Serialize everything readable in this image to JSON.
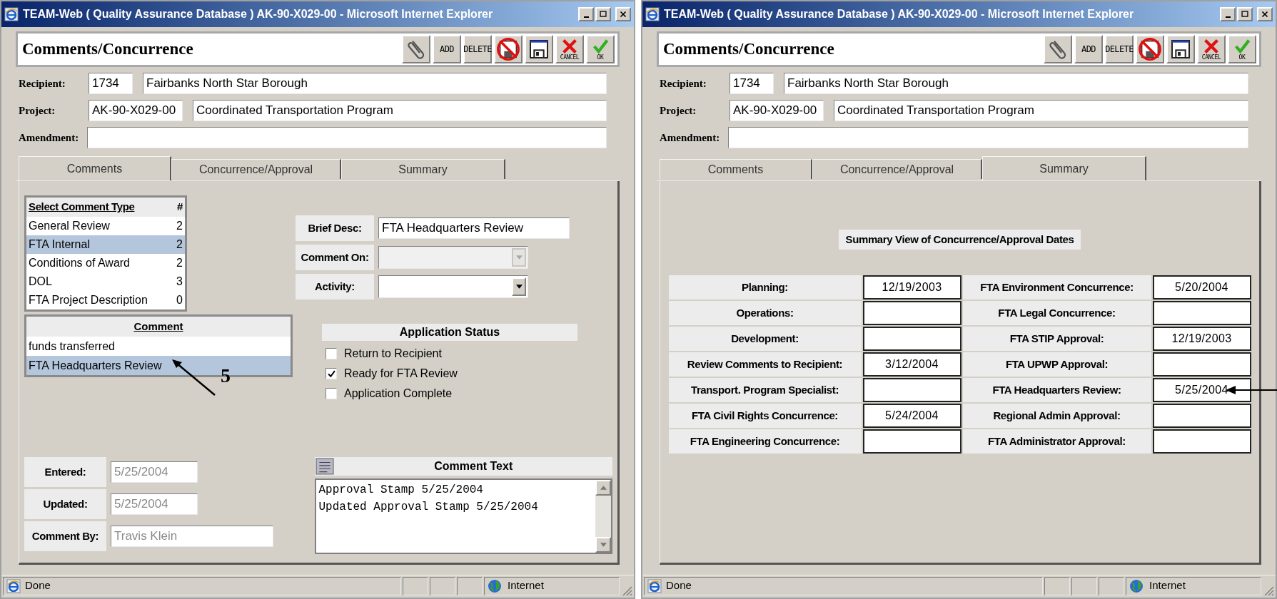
{
  "windows": [
    {
      "title": "TEAM-Web ( Quality Assurance Database ) AK-90-X029-00 - Microsoft Internet Explorer",
      "form_title": "Comments/Concurrence",
      "toolbar": [
        {
          "kind": "attach"
        },
        {
          "kind": "text",
          "label": "ADD"
        },
        {
          "kind": "text",
          "label": "DELETE"
        },
        {
          "kind": "nosave"
        },
        {
          "kind": "save"
        },
        {
          "kind": "cancel",
          "label": "CANCEL"
        },
        {
          "kind": "ok",
          "label": "OK"
        }
      ],
      "fields": [
        {
          "label": "Recipient:",
          "code": "1734",
          "name": "Fairbanks North Star Borough"
        },
        {
          "label": "Project:",
          "code": "AK-90-X029-00",
          "name": "Coordinated Transportation Program"
        },
        {
          "label": "Amendment:"
        }
      ],
      "tabs": [
        {
          "label": "Comments",
          "selected": true
        },
        {
          "label": "Concurrence/Approval",
          "selected": false
        },
        {
          "label": "Summary",
          "selected": false
        }
      ],
      "body": {
        "kind": "comments",
        "comment_types": {
          "columns": [
            "Select Comment Type",
            "#"
          ],
          "rows": [
            {
              "name": "General Review",
              "count": "2",
              "selected": false
            },
            {
              "name": "FTA Internal",
              "count": "2",
              "selected": true
            },
            {
              "name": "Conditions of Award",
              "count": "2",
              "selected": false
            },
            {
              "name": "DOL",
              "count": "3",
              "selected": false
            },
            {
              "name": "FTA Project Description",
              "count": "0",
              "selected": false
            }
          ]
        },
        "comments": {
          "heading": "Comment",
          "rows": [
            {
              "text": "funds transferred",
              "selected": false,
              "pointer": false
            },
            {
              "text": "FTA Headquarters Review",
              "selected": true,
              "pointer": true
            }
          ]
        },
        "annotation": "5",
        "selects": [
          {
            "label": "Brief Desc:",
            "kind": "text",
            "value": "FTA Headquarters Review"
          },
          {
            "label": "Comment On:",
            "kind": "dropdown",
            "disabled": true
          },
          {
            "label": "Activity:",
            "kind": "dropdown",
            "disabled": false
          }
        ],
        "application_status": {
          "title": "Application Status",
          "options": [
            {
              "label": "Return to Recipient",
              "checked": false
            },
            {
              "label": "Ready for FTA Review",
              "checked": true
            },
            {
              "label": "Application Complete",
              "checked": false
            }
          ]
        },
        "meta": [
          {
            "label": "Entered:",
            "value": "5/25/2004"
          },
          {
            "label": "Updated:",
            "value": "5/25/2004"
          },
          {
            "label": "Comment By:",
            "value": "Travis Klein"
          }
        ],
        "comment_text": {
          "title": "Comment Text",
          "lines": [
            "Approval Stamp 5/25/2004",
            "Updated Approval Stamp 5/25/2004"
          ]
        }
      },
      "status_bar": {
        "text": "Done",
        "zone": "Internet"
      }
    },
    {
      "title": "TEAM-Web ( Quality Assurance Database ) AK-90-X029-00 - Microsoft Internet Explorer",
      "form_title": "Comments/Concurrence",
      "toolbar": [
        {
          "kind": "attach"
        },
        {
          "kind": "text",
          "label": "ADD"
        },
        {
          "kind": "text",
          "label": "DELETE"
        },
        {
          "kind": "nosave"
        },
        {
          "kind": "save"
        },
        {
          "kind": "cancel",
          "label": "CANCEL"
        },
        {
          "kind": "ok",
          "label": "OK"
        }
      ],
      "fields": [
        {
          "label": "Recipient:",
          "code": "1734",
          "name": "Fairbanks North Star Borough"
        },
        {
          "label": "Project:",
          "code": "AK-90-X029-00",
          "name": "Coordinated Transportation Program"
        },
        {
          "label": "Amendment:"
        }
      ],
      "tabs": [
        {
          "label": "Comments",
          "selected": false
        },
        {
          "label": "Concurrence/Approval",
          "selected": false
        },
        {
          "label": "Summary",
          "selected": true
        }
      ],
      "body": {
        "kind": "summary",
        "heading": "Summary View of Concurrence/Approval Dates",
        "rows": [
          {
            "cells": [
              {
                "label": "Planning:",
                "value": "12/19/2003",
                "pointer": false
              },
              {
                "label": "FTA Environment Concurrence:",
                "value": "5/20/2004",
                "pointer": false
              }
            ]
          },
          {
            "cells": [
              {
                "label": "Operations:",
                "pointer": false
              },
              {
                "label": "FTA Legal Concurrence:",
                "pointer": false
              }
            ]
          },
          {
            "cells": [
              {
                "label": "Development:",
                "pointer": false
              },
              {
                "label": "FTA STIP Approval:",
                "value": "12/19/2003",
                "pointer": false
              }
            ]
          },
          {
            "cells": [
              {
                "label": "Review Comments to Recipient:",
                "value": "3/12/2004",
                "pointer": false
              },
              {
                "label": "FTA UPWP Approval:",
                "pointer": false
              }
            ]
          },
          {
            "cells": [
              {
                "label": "Transport. Program Specialist:",
                "pointer": false
              },
              {
                "label": "FTA Headquarters Review:",
                "value": "5/25/2004",
                "pointer": true
              }
            ]
          },
          {
            "cells": [
              {
                "label": "FTA Civil Rights Concurrence:",
                "value": "5/24/2004",
                "pointer": false
              },
              {
                "label": "Regional Admin Approval:",
                "pointer": false
              }
            ]
          },
          {
            "cells": [
              {
                "label": "FTA Engineering Concurrence:",
                "pointer": false
              },
              {
                "label": "FTA Administrator Approval:",
                "pointer": false
              }
            ]
          }
        ]
      },
      "status_bar": {
        "text": "Done",
        "zone": "Internet"
      }
    }
  ]
}
